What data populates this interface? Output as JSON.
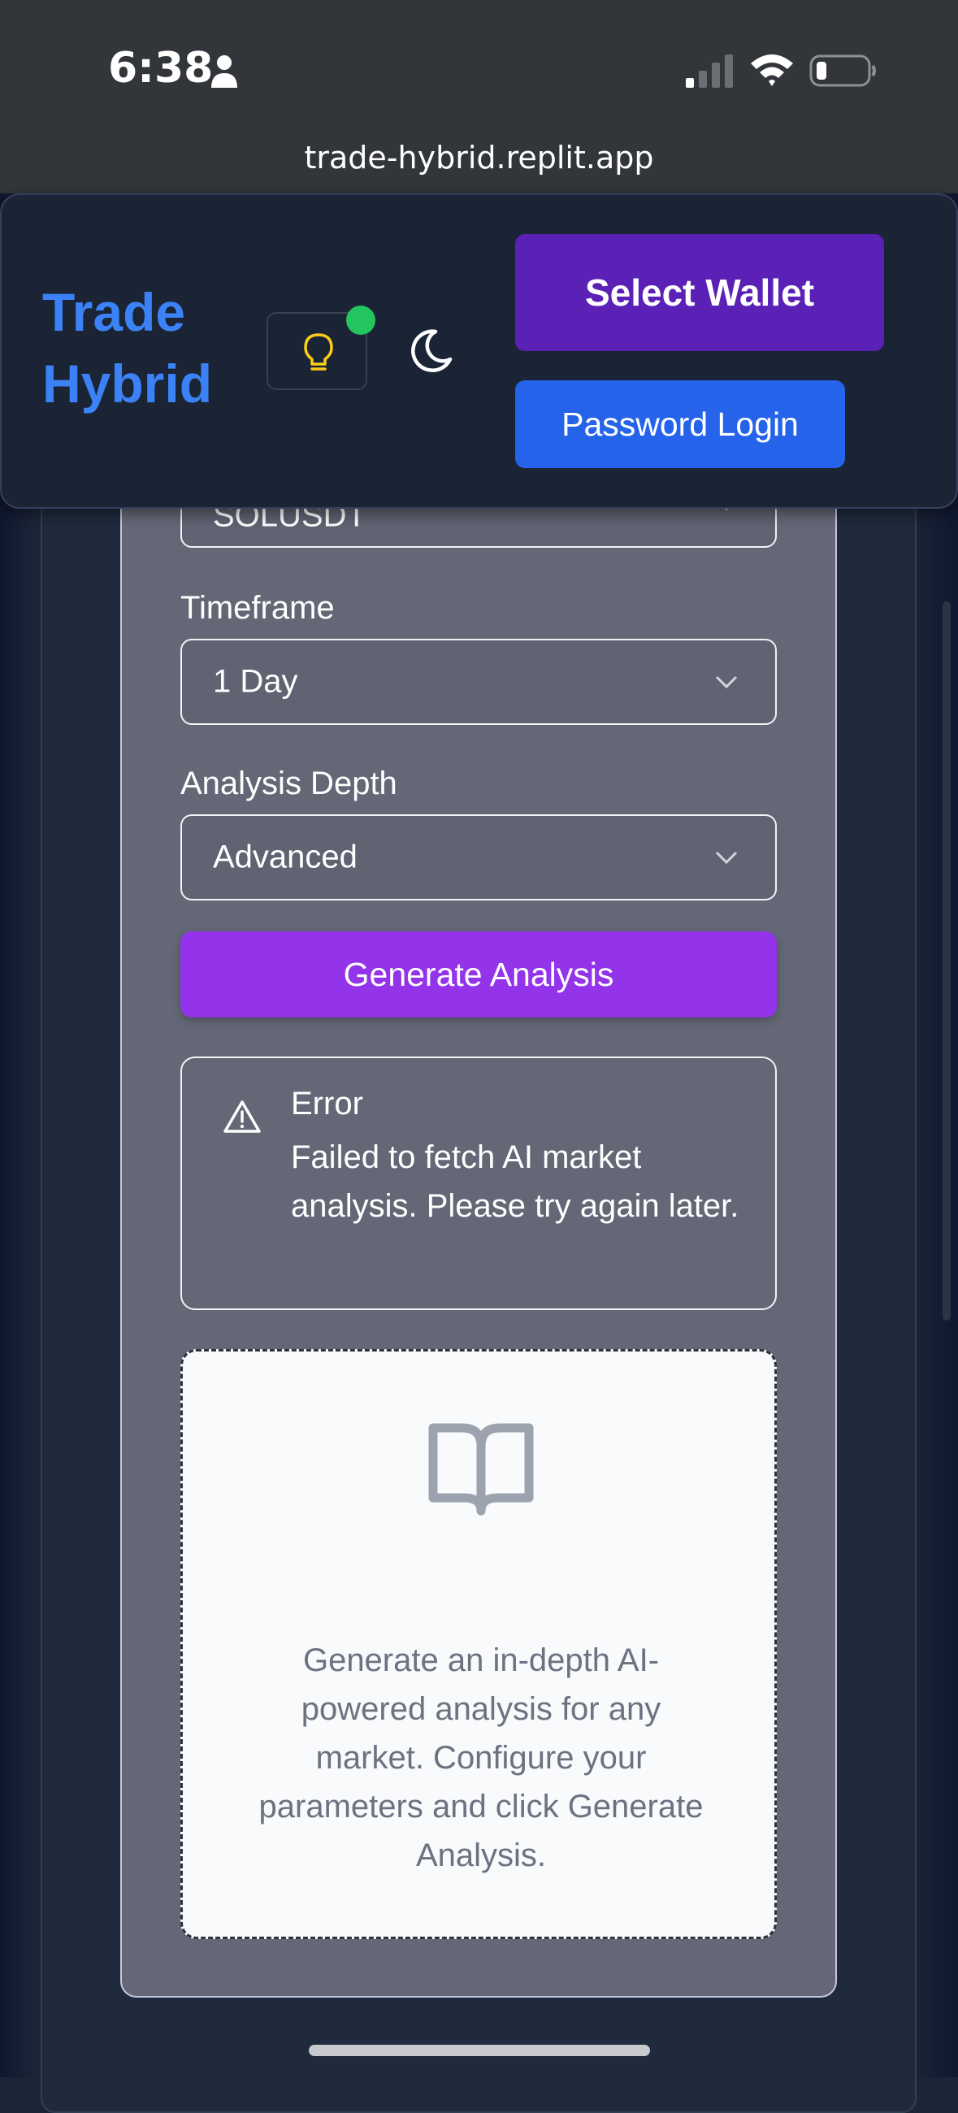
{
  "status_bar": {
    "time": "6:38",
    "url": "trade-hybrid.replit.app"
  },
  "header": {
    "logo_line1": "Trade",
    "logo_line2": "Hybrid",
    "select_wallet_label": "Select Wallet",
    "password_login_label": "Password Login"
  },
  "form": {
    "symbol_value": "SOLUSDT",
    "timeframe_label": "Timeframe",
    "timeframe_value": "1 Day",
    "depth_label": "Analysis Depth",
    "depth_value": "Advanced",
    "generate_label": "Generate Analysis"
  },
  "error": {
    "title": "Error",
    "message": "Failed to fetch AI market analysis. Please try again later."
  },
  "empty_state": {
    "text": "Generate an in-depth AI-powered analysis for any market. Configure your parameters and click Generate Analysis."
  },
  "colors": {
    "brand": "#3b82f6",
    "wallet_button": "#5b21b6",
    "password_button": "#2563eb",
    "generate_button": "#9333ea",
    "online": "#22c55e"
  },
  "icons": [
    "person-icon",
    "signal-icon",
    "wifi-icon",
    "battery-icon",
    "lightbulb-icon",
    "moon-icon",
    "chevron-down-icon",
    "warning-icon",
    "book-open-icon"
  ]
}
